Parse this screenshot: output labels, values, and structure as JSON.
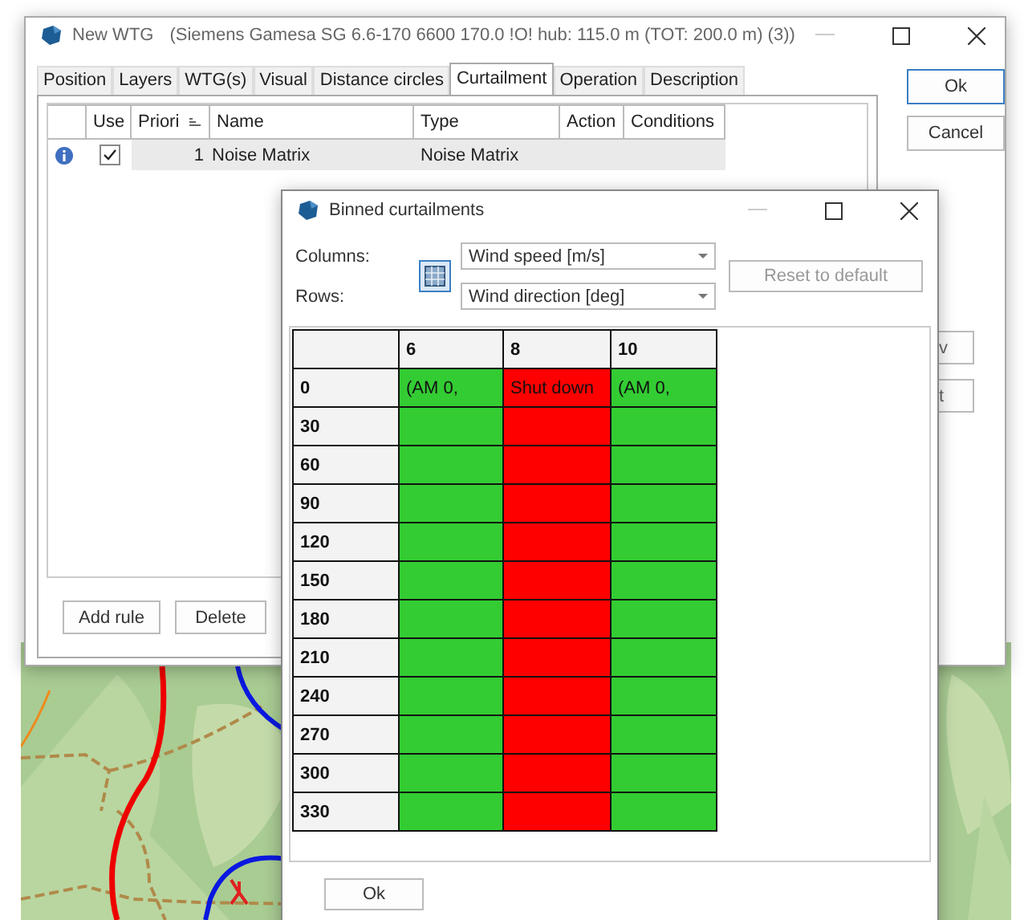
{
  "main_window": {
    "title": "New WTG",
    "subtitle": "(Siemens Gamesa SG 6.6-170 6600 170.0 !O! hub: 115.0 m (TOT: 200.0 m) (3))",
    "tabs": [
      {
        "label": "Position",
        "selected": false
      },
      {
        "label": "Layers",
        "selected": false
      },
      {
        "label": "WTG(s)",
        "selected": false
      },
      {
        "label": "Visual",
        "selected": false
      },
      {
        "label": "Distance circles",
        "selected": false
      },
      {
        "label": "Curtailment",
        "selected": true
      },
      {
        "label": "Operation",
        "selected": false
      },
      {
        "label": "Description",
        "selected": false
      }
    ],
    "table": {
      "columns": [
        "",
        "Use",
        "Priori",
        "Name",
        "Type",
        "Action",
        "Conditions"
      ],
      "rows": [
        {
          "checked": true,
          "priority": "1",
          "name": "Noise Matrix",
          "type": "Noise Matrix"
        }
      ]
    },
    "bottom_buttons": [
      "Add rule",
      "Delete"
    ],
    "side_buttons": [
      "Ok",
      "Cancel"
    ],
    "covered_buttons": [
      "v",
      "t"
    ]
  },
  "binned_dialog": {
    "title": "Binned curtailments",
    "columns_label": "Columns:",
    "columns_value": "Wind speed [m/s]",
    "rows_label": "Rows:",
    "rows_value": "Wind direction [deg]",
    "reset_button": "Reset to default",
    "grid": {
      "columns": [
        "6",
        "8",
        "10"
      ],
      "rows": [
        {
          "label": "0",
          "cells": [
            {
              "text": "(AM 0,",
              "color": "#33cc33"
            },
            {
              "text": "Shut down",
              "color": "#ff0000"
            },
            {
              "text": "(AM 0,",
              "color": "#33cc33"
            }
          ]
        },
        {
          "label": "30",
          "cells": [
            {
              "color": "#33cc33"
            },
            {
              "color": "#ff0000"
            },
            {
              "color": "#33cc33"
            }
          ]
        },
        {
          "label": "60",
          "cells": [
            {
              "color": "#33cc33"
            },
            {
              "color": "#ff0000"
            },
            {
              "color": "#33cc33"
            }
          ]
        },
        {
          "label": "90",
          "cells": [
            {
              "color": "#33cc33"
            },
            {
              "color": "#ff0000"
            },
            {
              "color": "#33cc33"
            }
          ]
        },
        {
          "label": "120",
          "cells": [
            {
              "color": "#33cc33"
            },
            {
              "color": "#ff0000"
            },
            {
              "color": "#33cc33"
            }
          ]
        },
        {
          "label": "150",
          "cells": [
            {
              "color": "#33cc33"
            },
            {
              "color": "#ff0000"
            },
            {
              "color": "#33cc33"
            }
          ]
        },
        {
          "label": "180",
          "cells": [
            {
              "color": "#33cc33"
            },
            {
              "color": "#ff0000"
            },
            {
              "color": "#33cc33"
            }
          ]
        },
        {
          "label": "210",
          "cells": [
            {
              "color": "#33cc33"
            },
            {
              "color": "#ff0000"
            },
            {
              "color": "#33cc33"
            }
          ]
        },
        {
          "label": "240",
          "cells": [
            {
              "color": "#33cc33"
            },
            {
              "color": "#ff0000"
            },
            {
              "color": "#33cc33"
            }
          ]
        },
        {
          "label": "270",
          "cells": [
            {
              "color": "#33cc33"
            },
            {
              "color": "#ff0000"
            },
            {
              "color": "#33cc33"
            }
          ]
        },
        {
          "label": "300",
          "cells": [
            {
              "color": "#33cc33"
            },
            {
              "color": "#ff0000"
            },
            {
              "color": "#33cc33"
            }
          ]
        },
        {
          "label": "330",
          "cells": [
            {
              "color": "#33cc33"
            },
            {
              "color": "#ff0000"
            },
            {
              "color": "#33cc33"
            }
          ]
        }
      ]
    },
    "ok_button": "Ok"
  }
}
